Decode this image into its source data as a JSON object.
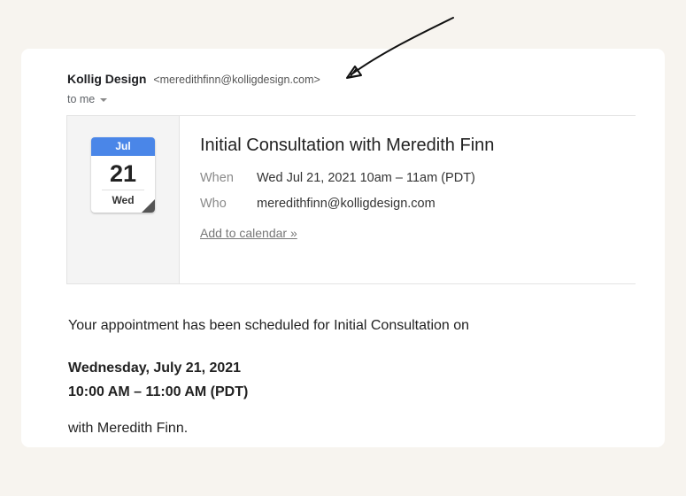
{
  "email": {
    "sender_name": "Kollig Design",
    "sender_email": "<meredithfinn@kolligdesign.com>",
    "recipient": "to me"
  },
  "invite": {
    "calendar_icon": {
      "month": "Jul",
      "day": "21",
      "weekday": "Wed"
    },
    "title": "Initial Consultation with Meredith Finn",
    "when_label": "When",
    "when_value": "Wed Jul 21, 2021 10am – 11am (PDT)",
    "who_label": "Who",
    "who_value": "meredithfinn@kolligdesign.com",
    "add_to_calendar": "Add to calendar »"
  },
  "message": {
    "intro": "Your appointment has been scheduled for Initial Consultation on",
    "date": "Wednesday, July 21, 2021",
    "time": "10:00 AM – 11:00 AM (PDT)",
    "closing": "with Meredith Finn."
  },
  "colors": {
    "page_background": "#f7f4ef",
    "calendar_month_header": "#4a86e8"
  }
}
